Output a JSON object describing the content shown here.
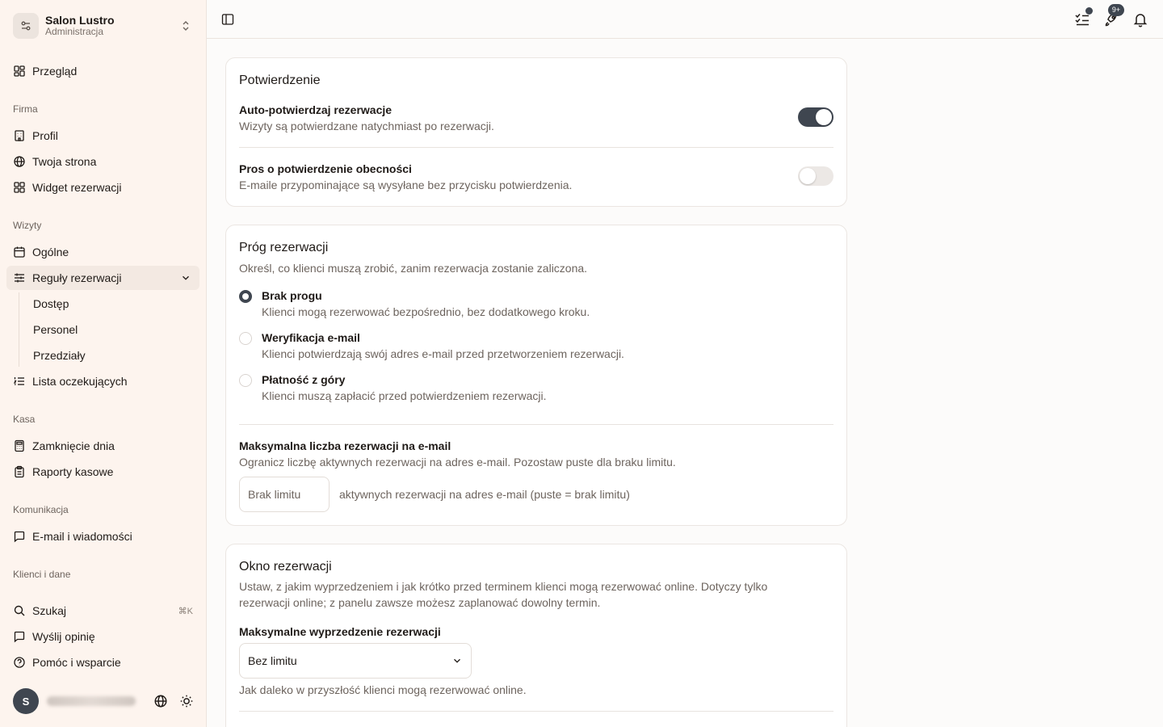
{
  "brand": {
    "name": "Salon Lustro",
    "subtitle": "Administracja"
  },
  "nav": {
    "overview": "Przegląd",
    "sections": {
      "company": "Firma",
      "visits": "Wizyty",
      "cash": "Kasa",
      "communication": "Komunikacja",
      "clients": "Klienci i dane"
    },
    "profile": "Profil",
    "website": "Twoja strona",
    "widget": "Widget rezerwacji",
    "general": "Ogólne",
    "booking_rules": "Reguły rezerwacji",
    "sub": [
      "Dostęp",
      "Personel",
      "Przedziały"
    ],
    "waitlist": "Lista oczekujących",
    "day_close": "Zamknięcie dnia",
    "cash_reports": "Raporty kasowe",
    "email_messages": "E-mail i wiadomości",
    "search": "Szukaj",
    "search_shortcut": "⌘K",
    "feedback": "Wyślij opinię",
    "help": "Pomóc i wsparcie"
  },
  "user": {
    "initial": "S",
    "email": "▒▒▒▒▒ ▒▒▒▒▒▒▒▒"
  },
  "topbar": {
    "badge_count": "9+"
  },
  "confirmation": {
    "title": "Potwierdzenie",
    "auto_label": "Auto-potwierdzaj rezerwacje",
    "auto_desc": "Wizyty są potwierdzane natychmiast po rezerwacji.",
    "auto_on": true,
    "presence_label": "Pros o potwierdzenie obecności",
    "presence_desc": "E-maile przypominające są wysyłane bez przycisku potwierdzenia.",
    "presence_on": false
  },
  "threshold": {
    "title": "Próg rezerwacji",
    "desc": "Określ, co klienci muszą zrobić, zanim rezerwacja zostanie zaliczona.",
    "options": [
      {
        "label": "Brak progu",
        "desc": "Klienci mogą rezerwować bezpośrednio, bez dodatkowego kroku.",
        "checked": true
      },
      {
        "label": "Weryfikacja e-mail",
        "desc": "Klienci potwierdzają swój adres e-mail przed przetworzeniem rezerwacji.",
        "checked": false
      },
      {
        "label": "Płatność z góry",
        "desc": "Klienci muszą zapłacić przed potwierdzeniem rezerwacji.",
        "checked": false
      }
    ],
    "max_label": "Maksymalna liczba rezerwacji na e-mail",
    "max_desc": "Ogranicz liczbę aktywnych rezerwacji na adres e-mail. Pozostaw puste dla braku limitu.",
    "max_placeholder": "Brak limitu",
    "max_hint": "aktywnych rezerwacji na adres e-mail (puste = brak limitu)"
  },
  "window": {
    "title": "Okno rezerwacji",
    "desc": "Ustaw, z jakim wyprzedzeniem i jak krótko przed terminem klienci mogą rezerwować online. Dotyczy tylko rezerwacji online; z panelu zawsze możesz zaplanować dowolny termin.",
    "advance_label": "Maksymalne wyprzedzenie rezerwacji",
    "advance_value": "Bez limitu",
    "advance_hint": "Jak daleko w przyszłość klienci mogą rezerwować online."
  },
  "colors": {
    "accent": "#3f4650",
    "sidebar_bg": "#fdf4ee"
  }
}
